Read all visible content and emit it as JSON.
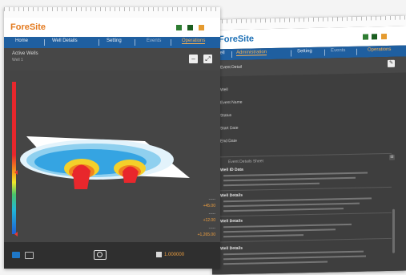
{
  "front": {
    "logo": "ForeSite",
    "tabs": [
      "Home",
      "Well Details",
      "Setting",
      "Events",
      "Operations"
    ],
    "subtitle": "Active Wells",
    "subsubtitle": "Well 1",
    "readouts": [
      "-----",
      "+45.00",
      "-----",
      "+12.00",
      "-----",
      "+1,265.00"
    ],
    "footer_value": "1.000000"
  },
  "back": {
    "logo": "ForeSite",
    "tabs": [
      "Well",
      "Administration",
      "Setting",
      "Events",
      "Operations"
    ],
    "header": "Event Detail",
    "fields": [
      "Well",
      "Event Name",
      "Status",
      "Start Date",
      "End Date"
    ],
    "sections": [
      "Event Details Sheet",
      "Well ID Data",
      "Well Details",
      "Well Details",
      "Well Details"
    ]
  },
  "colors": {
    "nav": "#1f5fa0",
    "accent": "#ffb24d",
    "logo_blue": "#1b6fb5",
    "logo_orange": "#e37a1f"
  }
}
